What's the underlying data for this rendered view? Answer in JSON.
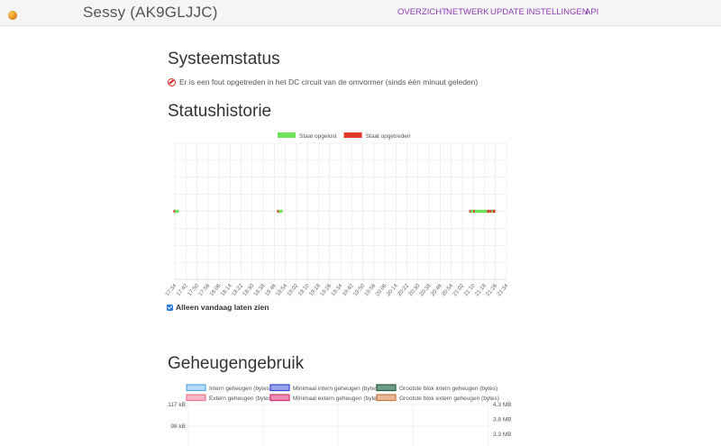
{
  "app": {
    "title": "Sessy (AK9GLJJC)",
    "nav": [
      "OVERZICHT",
      "NETWERK",
      "UPDATE",
      "INSTELLINGEN",
      "API"
    ]
  },
  "status": {
    "heading": "Systeemstatus",
    "message": "Er is een fout opgetreden in het DC circuit van de omvormer (sinds één minuut geleden)"
  },
  "history": {
    "heading": "Statushistorie",
    "only_today_label": "Alleen vandaag laten zien",
    "only_today_checked": true
  },
  "memory": {
    "heading": "Geheugengebruik"
  },
  "colors": {
    "accent": "#8e3fb5",
    "resolved": "#6ee35a",
    "occurred": "#e03a2a"
  },
  "chart_data": [
    {
      "type": "scatter",
      "title": "",
      "legend": [
        "Staat opgelost",
        "Staat opgetreden"
      ],
      "legend_colors": [
        "#6ee35a",
        "#e03a2a"
      ],
      "legend_position": "top",
      "x_ticks": [
        "17:34",
        "17:42",
        "17:50",
        "17:58",
        "18:06",
        "18:14",
        "18:22",
        "18:30",
        "18:38",
        "18:46",
        "18:54",
        "19:02",
        "19:10",
        "19:18",
        "19:26",
        "19:34",
        "19:42",
        "19:50",
        "19:58",
        "20:06",
        "20:14",
        "20:22",
        "20:30",
        "20:38",
        "20:46",
        "20:54",
        "21:02",
        "21:10",
        "21:18",
        "21:26",
        "21:34"
      ],
      "grid": true,
      "events": [
        {
          "time": "17:34",
          "state": "occurred"
        },
        {
          "time": "17:35",
          "state": "resolved"
        },
        {
          "time": "17:36",
          "state": "resolved"
        },
        {
          "time": "18:49",
          "state": "occurred"
        },
        {
          "time": "18:50",
          "state": "resolved"
        },
        {
          "time": "18:51",
          "state": "resolved"
        },
        {
          "time": "21:08",
          "state": "occurred"
        },
        {
          "time": "21:09",
          "state": "resolved"
        },
        {
          "time": "21:10",
          "state": "resolved"
        },
        {
          "time": "21:11",
          "state": "occurred"
        },
        {
          "time": "21:12",
          "state": "resolved"
        },
        {
          "time": "21:13",
          "state": "resolved"
        },
        {
          "time": "21:14",
          "state": "resolved"
        },
        {
          "time": "21:15",
          "state": "resolved"
        },
        {
          "time": "21:16",
          "state": "resolved"
        },
        {
          "time": "21:17",
          "state": "resolved"
        },
        {
          "time": "21:18",
          "state": "resolved"
        },
        {
          "time": "21:19",
          "state": "resolved"
        },
        {
          "time": "21:20",
          "state": "resolved"
        },
        {
          "time": "21:21",
          "state": "occurred"
        },
        {
          "time": "21:23",
          "state": "occurred"
        },
        {
          "time": "21:24",
          "state": "resolved"
        },
        {
          "time": "21:25",
          "state": "occurred"
        }
      ]
    },
    {
      "type": "line",
      "legend": [
        "Intern geheugen (bytes)",
        "Minimaal intern geheugen (bytes)",
        "Grootste blok intern geheugen (bytes)",
        "Extern geheugen (bytes)",
        "Minimaal extern geheugen (bytes)",
        "Grootste blok extern geheugen (bytes)"
      ],
      "legend_fill": [
        "#b8dcf6",
        "#9aa6ee",
        "#6f9e86",
        "#f4b6c3",
        "#ee8fb0",
        "#e8b898"
      ],
      "legend_stroke": [
        "#58a6e6",
        "#3545d8",
        "#2e5a44",
        "#ee7a92",
        "#d8307a",
        "#c87a3c"
      ],
      "legend_position": "top",
      "y_left_ticks": [
        "117 kB",
        "98 kB"
      ],
      "y_right_ticks": [
        "4.3 MB",
        "3.8 MB",
        "3.3 MB"
      ],
      "grid": true
    }
  ]
}
